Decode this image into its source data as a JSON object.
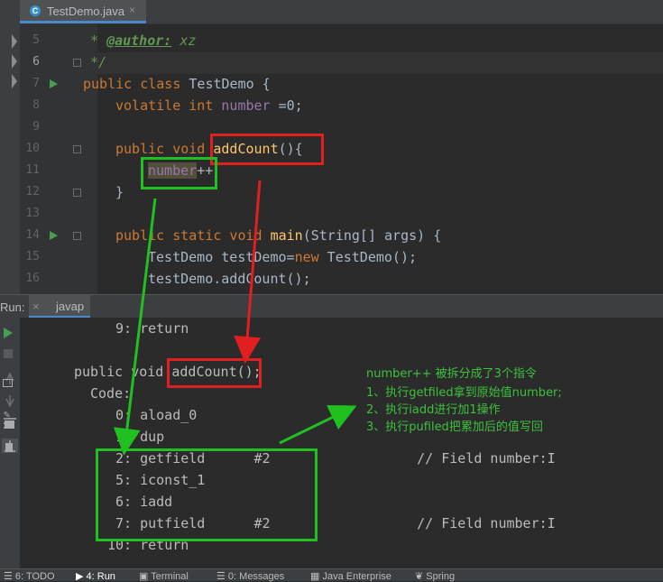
{
  "editor": {
    "tab_icon": "C",
    "tab_title": "TestDemo.java",
    "tab_close": "×",
    "line_numbers": [
      "5",
      "6",
      "7",
      "8",
      "9",
      "10",
      "11",
      "12",
      "13",
      "14",
      "15",
      "16"
    ],
    "lines": {
      "l5_star": "* ",
      "l5_tag": "@author:",
      "l5_rest": " xz",
      "l6": "*/",
      "l7_kw": "public class",
      "l7_rest": " TestDemo {",
      "l8_kw": "volatile int",
      "l8_field": "number",
      "l8_rest": " =0;",
      "l10_kw": "public void",
      "l10_method": "addCount",
      "l10_rest": "(){",
      "l11_field": "number",
      "l11_rest": "++",
      "l12": "}",
      "l14_kw": "public static void",
      "l14_method": "main",
      "l14_rest": "(String[] args) {",
      "l15_a": "TestDemo testDemo=",
      "l15_kw": "new",
      "l15_b": " TestDemo();",
      "l16": "testDemo.addCount();"
    }
  },
  "run_panel": {
    "label": "Run:",
    "tab": "javap",
    "output": {
      "o1": "9: return",
      "o2_a": "public void ",
      "o2_b": "addCount();",
      "o3": "Code:",
      "o4": "0: aload_0",
      "o5": "1: dup",
      "o6": "2: getfield      #2                  // Field number:I",
      "o7": "5: iconst_1",
      "o8": "6: iadd",
      "o9": "7: putfield      #2                  // Field number:I",
      "o10": "10: return"
    },
    "annotation": [
      "number++ 被拆分成了3个指令",
      "1、执行getfiled拿到原始值number;",
      "2、执行iadd进行加1操作",
      "3、执行pufiled把累加后的值写回"
    ]
  },
  "bottom_bar": {
    "todo": "6: TODO",
    "run": "4: Run",
    "terminal": "Terminal",
    "messages": "0: Messages",
    "java_enterprise": "Java Enterprise",
    "spring": "Spring"
  },
  "colors": {
    "highlight_red": "#e02020",
    "highlight_green": "#20c020",
    "annotation_green": "#3cc13c"
  }
}
